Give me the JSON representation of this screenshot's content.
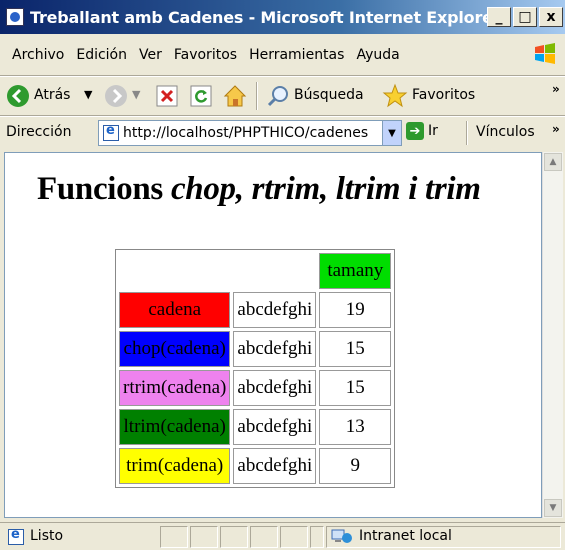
{
  "window": {
    "title": "Treballant amb Cadenes - Microsoft Internet Explorer",
    "buttons": {
      "minimize": "_",
      "maximize": "□",
      "close": "x"
    }
  },
  "menubar": {
    "items": [
      {
        "label": "Archivo",
        "access": "A"
      },
      {
        "label": "Edición",
        "access": "E"
      },
      {
        "label": "Ver",
        "access": "V"
      },
      {
        "label": "Favoritos",
        "access": "F"
      },
      {
        "label": "Herramientas",
        "access": "H"
      },
      {
        "label": "Ayuda",
        "access": "y"
      }
    ]
  },
  "toolbar": {
    "back_label": "Atrás",
    "search_label": "Búsqueda",
    "favorites_label": "Favoritos",
    "more": "»"
  },
  "addressbar": {
    "label": "Dirección",
    "url": "http://localhost/PHPTHICO/cadenes",
    "go_label": "Ir",
    "links_label": "Vínculos",
    "more": "»"
  },
  "page": {
    "title_plain": "Funcions ",
    "title_italic": "chop, rtrim, ltrim i trim",
    "table": {
      "header": {
        "size_label": "tamany",
        "size_bg": "#00DD00"
      },
      "rows": [
        {
          "label": "cadena",
          "value": "abcdefghi",
          "size": "19",
          "bg": "#FF0000"
        },
        {
          "label": "chop(cadena)",
          "value": "abcdefghi",
          "size": "15",
          "bg": "#0000FF"
        },
        {
          "label": "rtrim(cadena)",
          "value": "abcdefghi",
          "size": "15",
          "bg": "#EE82EE"
        },
        {
          "label": "ltrim(cadena)",
          "value": "abcdefghi",
          "size": "13",
          "bg": "#008000"
        },
        {
          "label": "trim(cadena)",
          "value": "abcdefghi",
          "size": "9",
          "bg": "#FFFF00"
        }
      ]
    }
  },
  "statusbar": {
    "status": "Listo",
    "zone": "Intranet local"
  }
}
